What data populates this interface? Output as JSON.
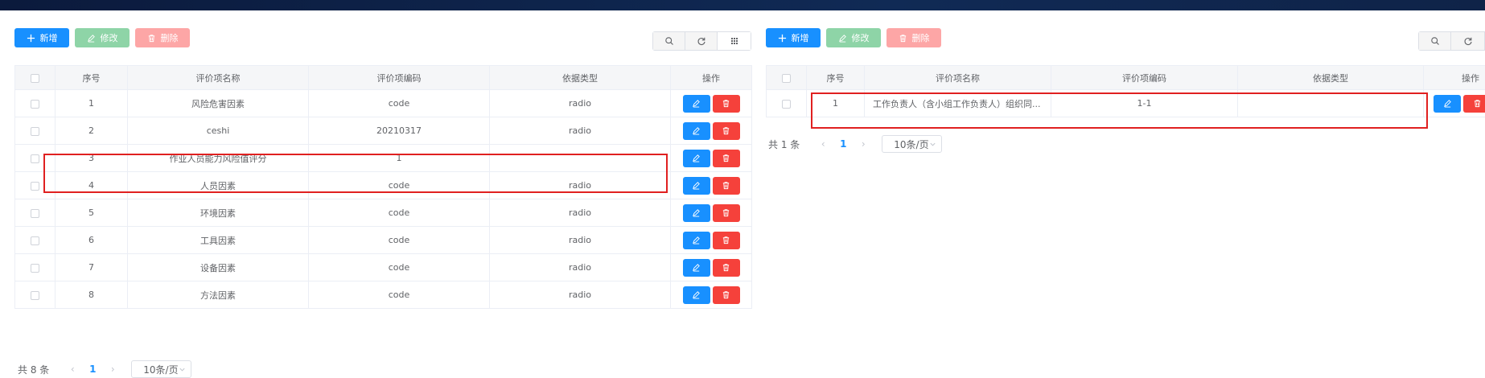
{
  "colors": {
    "primary": "#1890ff",
    "success": "#8ed4a7",
    "danger_light": "#fda6a6",
    "danger": "#f5413b",
    "highlight": "#e02020"
  },
  "left": {
    "toolbar": {
      "add_label": "新增",
      "edit_label": "修改",
      "delete_label": "删除"
    },
    "tools": [
      "search-icon",
      "refresh-icon",
      "grid-icon"
    ],
    "columns": [
      "序号",
      "评价项名称",
      "评价项编码",
      "依据类型",
      "操作"
    ],
    "rows": [
      {
        "no": "1",
        "name": "风险危害因素",
        "code": "code",
        "type": "radio"
      },
      {
        "no": "2",
        "name": "ceshi",
        "code": "20210317",
        "type": "radio"
      },
      {
        "no": "3",
        "name": "作业人员能力风险值评分",
        "code": "1",
        "type": ""
      },
      {
        "no": "4",
        "name": "人员因素",
        "code": "code",
        "type": "radio"
      },
      {
        "no": "5",
        "name": "环境因素",
        "code": "code",
        "type": "radio"
      },
      {
        "no": "6",
        "name": "工具因素",
        "code": "code",
        "type": "radio"
      },
      {
        "no": "7",
        "name": "设备因素",
        "code": "code",
        "type": "radio"
      },
      {
        "no": "8",
        "name": "方法因素",
        "code": "code",
        "type": "radio"
      }
    ],
    "pager": {
      "total": "共 8 条",
      "prev": "‹",
      "page": "1",
      "next": "›",
      "size": "10条/页"
    }
  },
  "right": {
    "toolbar": {
      "add_label": "新增",
      "edit_label": "修改",
      "delete_label": "删除"
    },
    "tools": [
      "search-icon",
      "refresh-icon"
    ],
    "columns": [
      "序号",
      "评价项名称",
      "评价项编码",
      "依据类型",
      "操作"
    ],
    "rows": [
      {
        "no": "1",
        "name": "工作负责人（含小组工作负责人）组织同...",
        "code": "1-1",
        "type": ""
      }
    ],
    "pager": {
      "total": "共 1 条",
      "prev": "‹",
      "page": "1",
      "next": "›",
      "size": "10条/页"
    }
  }
}
